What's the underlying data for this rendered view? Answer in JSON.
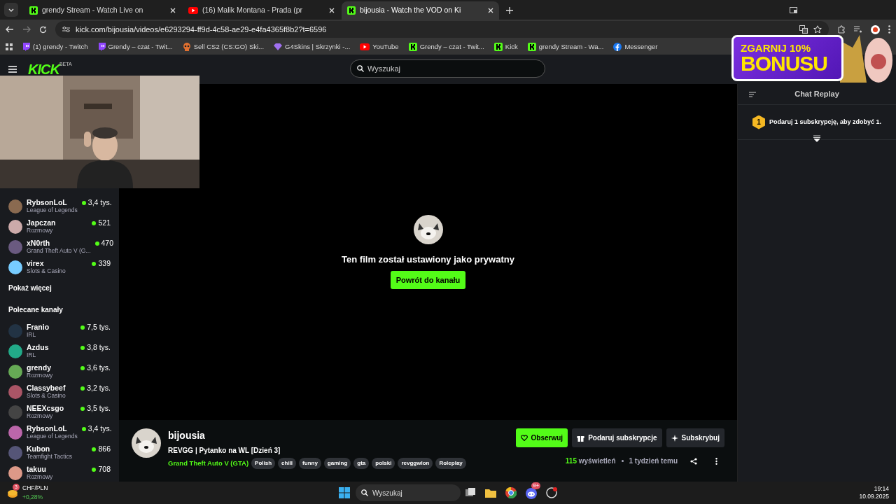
{
  "browser": {
    "tabs": [
      {
        "title": "grendy Stream - Watch Live on",
        "kind": "kick",
        "selected": false
      },
      {
        "title": "(16) Malik Montana - Prada (pr",
        "kind": "youtube",
        "selected": false
      },
      {
        "title": "bijousia - Watch the VOD on Ki",
        "kind": "kick",
        "selected": true
      }
    ],
    "url": "kick.com/bijousia/videos/e6293294-ff9d-4c58-ae29-e4fa4365f8b2?t=6596",
    "bookmarks": [
      {
        "label": "(1) grendy - Twitch",
        "kind": "twitch"
      },
      {
        "label": "Grendy – czat - Twit...",
        "kind": "twitch"
      },
      {
        "label": "Sell CS2 (CS:GO) Ski...",
        "kind": "skins"
      },
      {
        "label": "G4Skins | Skrzynki -...",
        "kind": "gem"
      },
      {
        "label": "YouTube",
        "kind": "youtube"
      },
      {
        "label": "Grendy – czat - Twit...",
        "kind": "kick"
      },
      {
        "label": "Kick",
        "kind": "kick"
      },
      {
        "label": "grendy Stream - Wa...",
        "kind": "kick"
      },
      {
        "label": "Messenger",
        "kind": "facebook"
      }
    ]
  },
  "ad": {
    "line1": "ZGARNIJ 10%",
    "line2": "BONUSU"
  },
  "header": {
    "logo": "KICK",
    "logo_badge": "BETA",
    "search": {
      "placeholder": "Wyszukaj"
    }
  },
  "sidebar": {
    "followed": [
      {
        "name": "RybsonLoL",
        "category": "League of Legends",
        "viewers": "3,4 tys."
      },
      {
        "name": "Japczan",
        "category": "Rozmowy",
        "viewers": "521"
      },
      {
        "name": "xN0rth",
        "category": "Grand Theft Auto V (G...",
        "viewers": "470"
      },
      {
        "name": "virex",
        "category": "Slots & Casino",
        "viewers": "339"
      }
    ],
    "show_more": "Pokaż więcej",
    "recommended_title": "Polecane kanały",
    "recommended": [
      {
        "name": "Franio",
        "category": "IRL",
        "viewers": "7,5 tys."
      },
      {
        "name": "Azdus",
        "category": "IRL",
        "viewers": "3,8 tys."
      },
      {
        "name": "grendy",
        "category": "Rozmowy",
        "viewers": "3,6 tys."
      },
      {
        "name": "Classybeef",
        "category": "Slots & Casino",
        "viewers": "3,2 tys."
      },
      {
        "name": "NEEXcsgo",
        "category": "Rozmowy",
        "viewers": "3,5 tys."
      },
      {
        "name": "RybsonLoL",
        "category": "League of Legends",
        "viewers": "3,4 tys."
      },
      {
        "name": "Kubon",
        "category": "Teamfight Tactics",
        "viewers": "866"
      },
      {
        "name": "takuu",
        "category": "Rozmowy",
        "viewers": "708"
      }
    ]
  },
  "player": {
    "message": "Ten film został ustawiony jako prywatny",
    "button": "Powrót do kanału"
  },
  "channel": {
    "name": "bijousia",
    "title": "REVGG | Pytanko na WL [Dzień 3]",
    "category": "Grand Theft Auto V (GTA)",
    "tags": [
      "Polish",
      "chill",
      "funny",
      "gaming",
      "gta",
      "polski",
      "revggwlon",
      "Roleplay"
    ],
    "follow": "Obserwuj",
    "gift": "Podaruj subskrypcje",
    "subscribe": "Subskrybuj",
    "views": "115",
    "views_label": "wyświetleń",
    "age": "1 tydzień temu"
  },
  "chat": {
    "title": "Chat Replay",
    "gift_badge": "1",
    "gift_text": "Podaruj 1 subskrypcję, aby zdobyć 1."
  },
  "taskbar": {
    "widget_badge": "3",
    "widget_title": "CHF/PLN",
    "widget_change": "+0,28%",
    "search": {
      "placeholder": "Wyszukaj"
    },
    "discord_badge": "9+",
    "time": "19:14",
    "date": "10.09.2025"
  }
}
